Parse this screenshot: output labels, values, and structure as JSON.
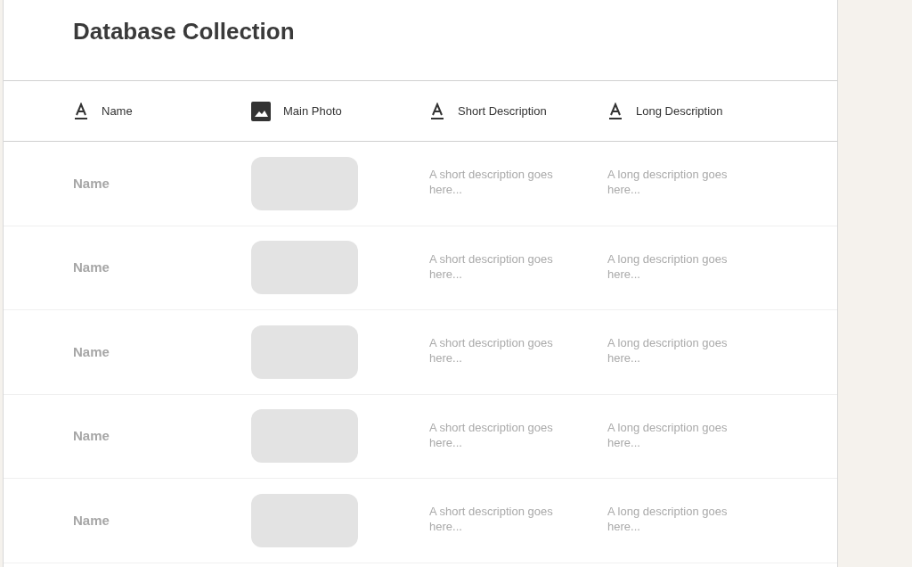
{
  "title": "Database Collection",
  "columns": [
    {
      "label": "Name",
      "kind": "text"
    },
    {
      "label": "Main Photo",
      "kind": "image"
    },
    {
      "label": "Short Description",
      "kind": "text"
    },
    {
      "label": "Long Description",
      "kind": "text"
    }
  ],
  "rows": [
    {
      "name": "Name",
      "short": "A short description goes here...",
      "long": "A long description goes here..."
    },
    {
      "name": "Name",
      "short": "A short description goes here...",
      "long": "A long description goes here..."
    },
    {
      "name": "Name",
      "short": "A short description goes here...",
      "long": "A long description goes here..."
    },
    {
      "name": "Name",
      "short": "A short description goes here...",
      "long": "A long description goes here..."
    },
    {
      "name": "Name",
      "short": "A short description goes here...",
      "long": "A long description goes here..."
    }
  ]
}
